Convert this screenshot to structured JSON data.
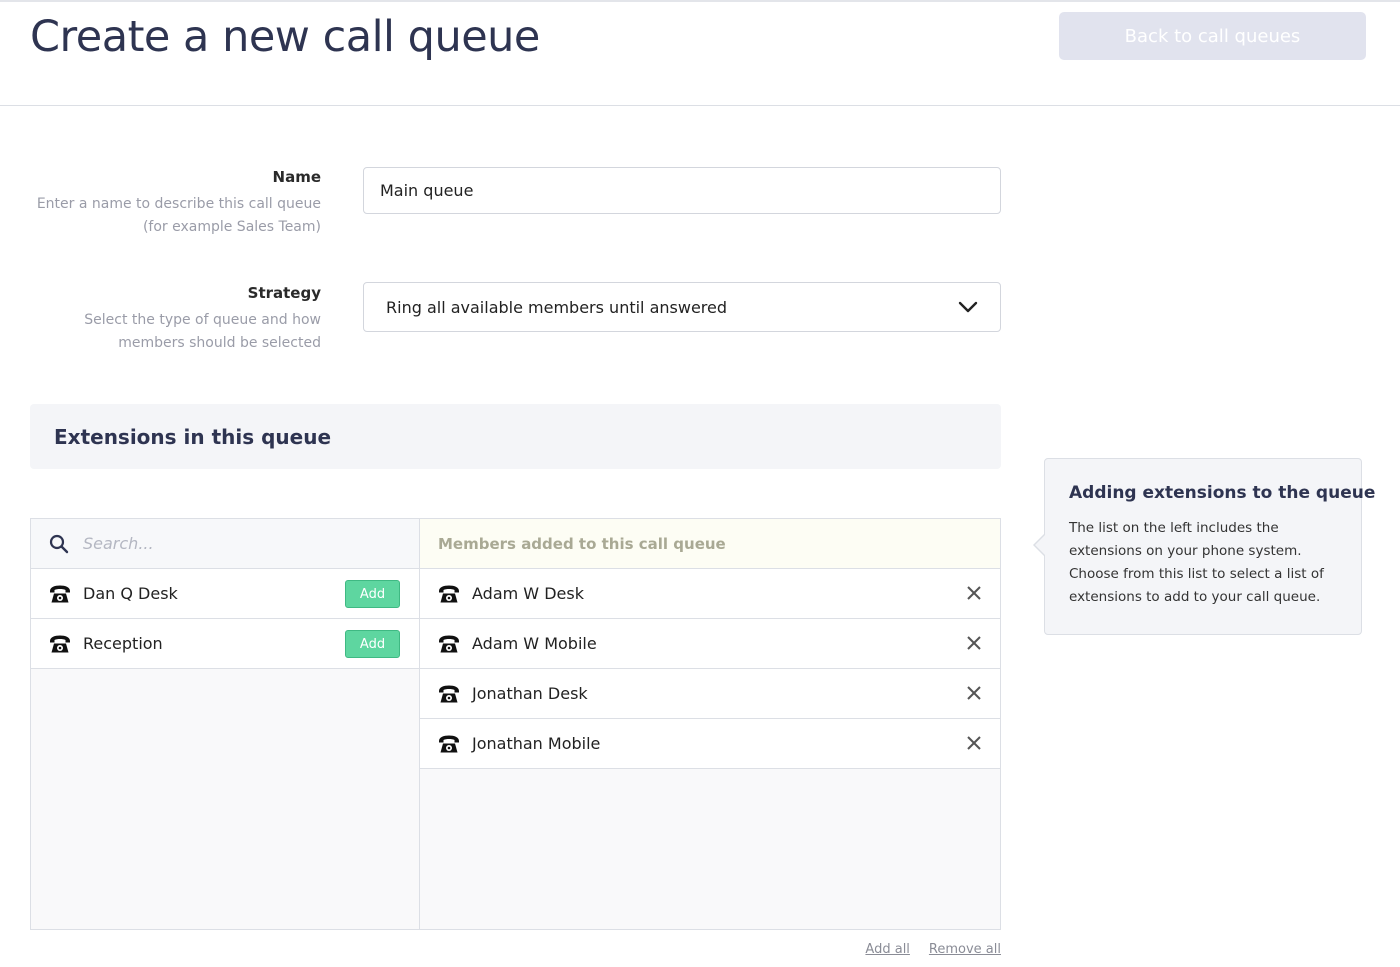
{
  "header": {
    "title": "Create a new call queue",
    "back_button": "Back to call queues"
  },
  "form": {
    "name": {
      "label": "Name",
      "help_line1": "Enter a name to describe this call queue",
      "help_line2": "(for example Sales Team)",
      "value": "Main queue"
    },
    "strategy": {
      "label": "Strategy",
      "help_line1": "Select the type of queue and how",
      "help_line2": "members should be selected",
      "selected": "Ring all available members until answered"
    }
  },
  "extensions": {
    "section_title": "Extensions in this queue",
    "search_placeholder": "Search...",
    "available": [
      {
        "name": "Dan Q Desk",
        "action": "Add"
      },
      {
        "name": "Reception",
        "action": "Add"
      }
    ],
    "members_header": "Members added to this call queue",
    "members": [
      {
        "name": "Adam W Desk"
      },
      {
        "name": "Adam W Mobile"
      },
      {
        "name": "Jonathan Desk"
      },
      {
        "name": "Jonathan Mobile"
      }
    ],
    "add_all": "Add all",
    "remove_all": "Remove all"
  },
  "help_panel": {
    "title": "Adding extensions to the queue",
    "body": "The list on the left includes the extensions on your phone system. Choose from this list to select a list of extensions to add to your call queue."
  },
  "colors": {
    "title": "#2e3451",
    "add_button": "#5ed6a0",
    "back_button_bg": "#e1e3ee"
  }
}
